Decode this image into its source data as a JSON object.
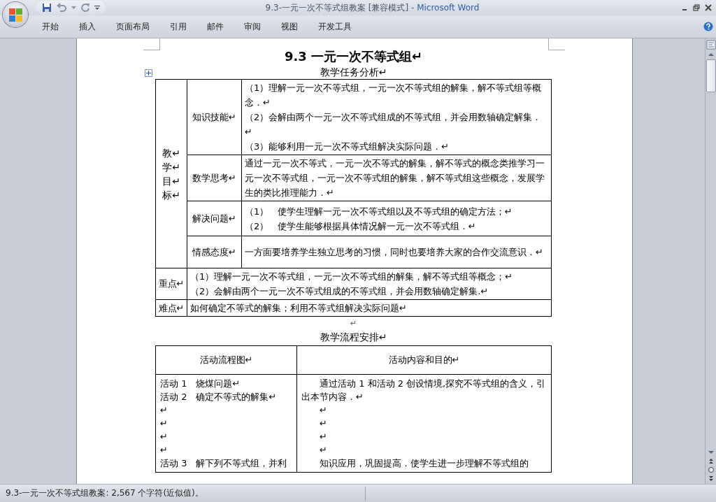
{
  "window": {
    "title": "9.3-一元一次不等式组教案 [兼容模式]",
    "app": " - Microsoft Word"
  },
  "tabs": [
    {
      "label": "开始"
    },
    {
      "label": "插入"
    },
    {
      "label": "页面布局"
    },
    {
      "label": "引用"
    },
    {
      "label": "邮件"
    },
    {
      "label": "审阅"
    },
    {
      "label": "视图"
    },
    {
      "label": "开发工具"
    }
  ],
  "document": {
    "title": "9.3  一元一次不等式组↵",
    "section1": "教学任务分析↵",
    "table1": {
      "goal_label_lines": [
        "教↵",
        "学↵",
        "目↵",
        "标↵"
      ],
      "goals": [
        {
          "label": "知识技能↵",
          "paragraphs": [
            "（1）理解一元一次不等式组，一元一次不等式组的解集，解不等式组等概念．↵",
            "（2）会解由两个一元一次不等式组成的不等式组，并会用数轴确定解集．↵",
            "（3）能够利用一元一次不等式组解决实际问题．↵"
          ]
        },
        {
          "label": "数学思考↵",
          "paragraphs": [
            "通过一元一次不等式，一元一次不等式的解集，解不等式的概念类推学习一元一次不等式组，一元一次不等式组的解集，解不等式组这些概念，发展学生的类比推理能力．↵"
          ]
        },
        {
          "label": "解决问题↵",
          "paragraphs": [
            "（1）   使学生理解一元一次不等式组以及不等式组的确定方法；↵",
            "（2）   使学生能够根据具体情况解一元一次不等式组．↵"
          ]
        },
        {
          "label": "情感态度↵",
          "paragraphs": [
            "一方面要培养学生独立思考的习惯，同时也要培养大家的合作交流意识．↵"
          ]
        }
      ],
      "rows": [
        {
          "label": "重点↵",
          "paragraphs": [
            "（1）理解一元一次不等式组，一元一次不等式组的解集，解不等式组等概念；↵",
            "（2）会解由两个一元一次不等式组成的不等式组，并会用数轴确定解集.↵"
          ]
        },
        {
          "label": "难点↵",
          "paragraphs": [
            "如何确定不等式的解集；利用不等式组解决实际问题↵"
          ]
        }
      ]
    },
    "blank": "↵",
    "section2": "教学流程安排↵",
    "table2": {
      "headers": [
        "活动流程图↵",
        "活动内容和目的↵"
      ],
      "left": [
        "活动 1　烧煤问题↵",
        "活动 2　确定不等式的解集↵",
        "↵",
        "↵",
        "↵",
        "↵",
        "活动 3　解下列不等式组，并利"
      ],
      "right": [
        "通过活动 1 和活动 2 创设情境,探究不等式组的含义，引出本节内容．↵",
        "↵",
        "↵",
        "↵",
        "↵",
        "知识应用，巩固提高．使学生进一步理解不等式组的"
      ]
    }
  },
  "status_bar": {
    "text": "9.3-一元一次不等式组教案: 2,567 个字符(近似值)。"
  }
}
